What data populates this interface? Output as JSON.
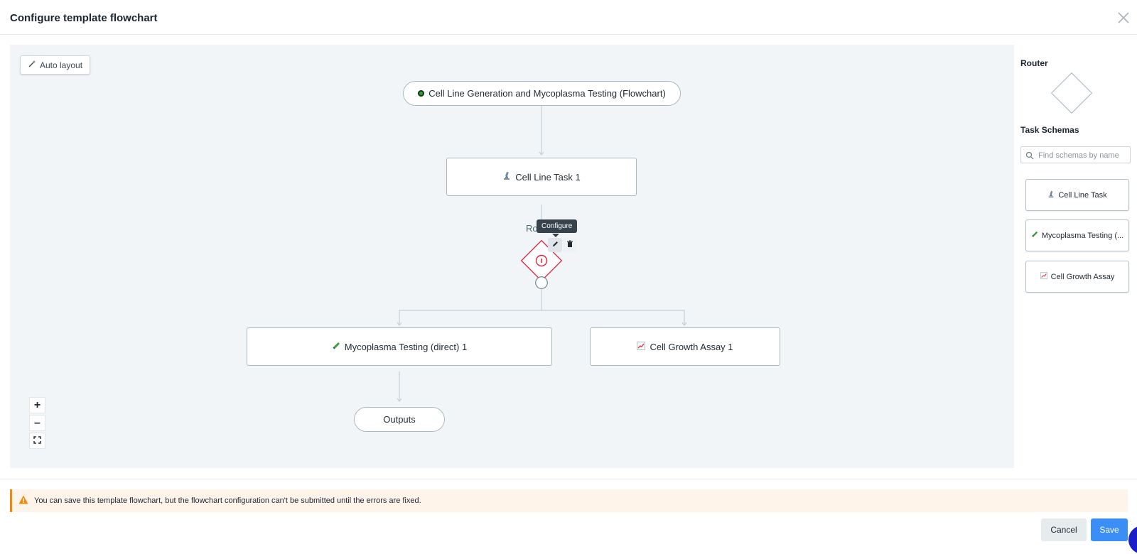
{
  "dialog": {
    "title": "Configure template flowchart"
  },
  "canvas": {
    "auto_layout_label": "Auto layout",
    "start_node_label": "Cell Line Generation and Mycoplasma Testing (Flowchart)",
    "task_node_1_label": "Cell Line Task 1",
    "router_label": "Ro",
    "tooltip_label": "Configure",
    "branch_left_label": "Mycoplasma Testing (direct) 1",
    "branch_right_label": "Cell Growth Assay 1",
    "outputs_label": "Outputs",
    "zoom": {
      "in": "+",
      "out": "–"
    },
    "colors": {
      "edge": "#c5d0d6",
      "error": "#e3233b",
      "start_dot": "#2e9e35"
    }
  },
  "panel": {
    "router_heading": "Router",
    "task_schemas_heading": "Task Schemas",
    "search_placeholder": "Find schemas by name",
    "schemas": [
      {
        "label": "Cell Line Task",
        "icon": "microscope-icon"
      },
      {
        "label": "Mycoplasma Testing (...",
        "icon": "test-tube-icon"
      },
      {
        "label": "Cell Growth Assay",
        "icon": "chart-icon"
      }
    ]
  },
  "footer": {
    "warning_text": "You can save this template flowchart, but the flowchart configuration can't be submitted until the errors are fixed.",
    "cancel_label": "Cancel",
    "save_label": "Save",
    "colors": {
      "warning": "#f08a0c",
      "primary": "#3a8ef6"
    }
  }
}
